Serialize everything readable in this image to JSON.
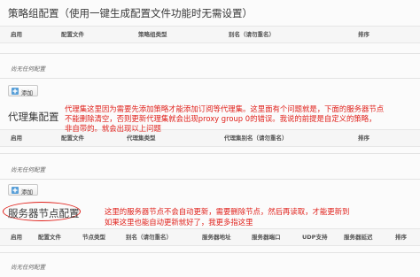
{
  "strategy_section": {
    "title": "策略组配置（使用一键生成配置文件功能时无需设置）",
    "columns": [
      "启用",
      "配置文件",
      "策略组类型",
      "别名（请勿重名）",
      "排序"
    ],
    "empty_text": "尚无任何配置",
    "add_label": "添加"
  },
  "proxy_section": {
    "title": "代理集配置",
    "columns": [
      "启用",
      "配置文件",
      "代理集类型",
      "代理集别名（请勿重名）",
      "排序"
    ],
    "empty_text": "尚无任何配置",
    "add_label": "添加",
    "note_lines": [
      "代理集这里因为需要先添加策略才能添加订阅等代理集。这里面有个问题就是，下面的服务器节点",
      "不能删除清空，否则更新代理集就会出现proxy group 0的错误。我说的前提是自定义的策略，",
      "非自带的。就会出现以上问题"
    ]
  },
  "server_section": {
    "title": "服务器节点配置",
    "columns": [
      "启用",
      "配置文件",
      "节点类型",
      "别名（请勿重名）",
      "服务器地址",
      "服务器端口",
      "UDP支持",
      "服务器延迟",
      "排序"
    ],
    "empty_text": "尚无任何配置",
    "note_lines": [
      "这里的服务器节点不会自动更新，需要删除节点，然后再读取，才能更新到",
      "如果这里也能自动更新就好了，我更多指这里"
    ]
  },
  "colors": {
    "annotation": "#e0211b",
    "button_icon": "#5aa0d8"
  }
}
